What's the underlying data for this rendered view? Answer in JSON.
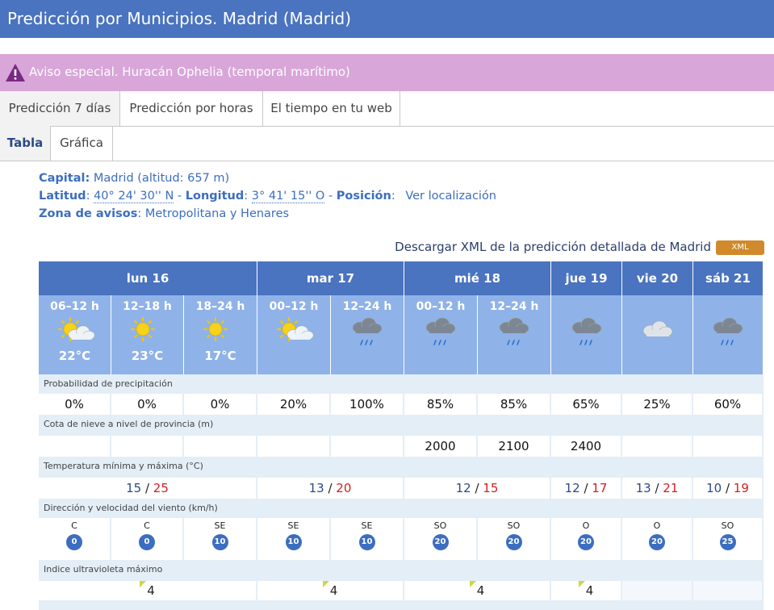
{
  "header": {
    "title": "Predicción por Municipios. Madrid (Madrid)"
  },
  "alert": {
    "text": "Aviso especial. Huracán Ophelia (temporal marítimo)",
    "color": "#d8a6d8"
  },
  "tabs": [
    {
      "label": "Predicción 7 días"
    },
    {
      "label": "Predicción por horas"
    },
    {
      "label": "El tiempo en tu web"
    }
  ],
  "subtabs": [
    {
      "label": "Tabla"
    },
    {
      "label": "Gráfica"
    }
  ],
  "info": {
    "capital_label": "Capital:",
    "capital_value": "Madrid (altitud: 657 m)",
    "lat_label": "Latitud",
    "lat_value": "40° 24' 30'' N",
    "lon_label": "Longitud",
    "lon_value": "3° 41' 15'' O",
    "pos_label": "Posición",
    "pos_link": "Ver localización",
    "zone_label": "Zona de avisos",
    "zone_value": "Metropolitana y Henares"
  },
  "xml": {
    "text": "Descargar XML de la predicción detallada de Madrid",
    "badge": "XML"
  },
  "days": [
    "lun 16",
    "mar 17",
    "mié 18",
    "jue 19",
    "vie 20",
    "sáb 21"
  ],
  "periods": [
    {
      "time": "06–12 h",
      "temp": "22°C",
      "icon": "sun-cloud-icon"
    },
    {
      "time": "12–18 h",
      "temp": "23°C",
      "icon": "sun-icon"
    },
    {
      "time": "18–24 h",
      "temp": "17°C",
      "icon": "sun-icon"
    },
    {
      "time": "00–12 h",
      "temp": "",
      "icon": "sun-cloud-icon"
    },
    {
      "time": "12–24 h",
      "temp": "",
      "icon": "rain-cloud-icon"
    },
    {
      "time": "00–12 h",
      "temp": "",
      "icon": "rain-cloud-icon"
    },
    {
      "time": "12–24 h",
      "temp": "",
      "icon": "rain-cloud-icon"
    },
    {
      "time": "",
      "temp": "",
      "icon": "rain-cloud-icon"
    },
    {
      "time": "",
      "temp": "",
      "icon": "cloud-icon"
    },
    {
      "time": "",
      "temp": "",
      "icon": "rain-cloud-icon"
    }
  ],
  "rows": {
    "precip_label": "Probabilidad de precipitación",
    "precip": [
      "0%",
      "0%",
      "0%",
      "20%",
      "100%",
      "85%",
      "85%",
      "65%",
      "25%",
      "60%"
    ],
    "snow_label": "Cota de nieve a nivel de provincia (m)",
    "snow": [
      "",
      "",
      "",
      "",
      "",
      "2000",
      "2100",
      "2400",
      "",
      ""
    ],
    "temp_label": "Temperatura mínima y máxima (°C)",
    "temps": [
      {
        "min": "15",
        "max": "25"
      },
      {
        "min": "13",
        "max": "20"
      },
      {
        "min": "12",
        "max": "15"
      },
      {
        "min": "12",
        "max": "17"
      },
      {
        "min": "13",
        "max": "21"
      },
      {
        "min": "10",
        "max": "19"
      }
    ],
    "temp_sep": " / ",
    "wind_label": "Dirección y velocidad del viento (km/h)",
    "wind": [
      {
        "dir": "C",
        "speed": "0"
      },
      {
        "dir": "C",
        "speed": "0"
      },
      {
        "dir": "SE",
        "speed": "10"
      },
      {
        "dir": "SE",
        "speed": "10"
      },
      {
        "dir": "SE",
        "speed": "10"
      },
      {
        "dir": "SO",
        "speed": "20"
      },
      {
        "dir": "SO",
        "speed": "20"
      },
      {
        "dir": "O",
        "speed": "20"
      },
      {
        "dir": "O",
        "speed": "20"
      },
      {
        "dir": "SO",
        "speed": "25"
      }
    ],
    "uv_label": "Indice ultravioleta máximo",
    "uv": [
      "4",
      "4",
      "4",
      "4",
      "",
      ""
    ]
  },
  "colors": {
    "header": "#4a73c0",
    "period": "#8fb2e8",
    "row_label": "#e4eef7",
    "tmax": "#d12020",
    "tmin": "#2a4a86"
  }
}
